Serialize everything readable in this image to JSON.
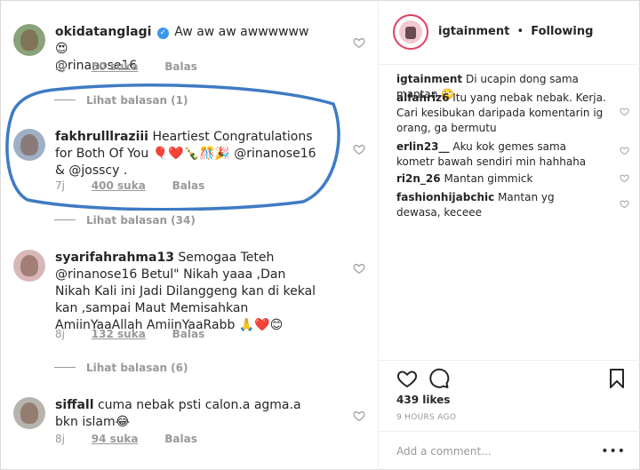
{
  "left_panel": {
    "comments": [
      {
        "username": "okidatanglagi",
        "verified": true,
        "text": "Aw aw aw awwwwww 😍",
        "mention": "@rinanose16",
        "time": "2j",
        "likes": "50 suka",
        "reply": "Balas"
      },
      {
        "view_replies": "Lihat balasan (1)"
      },
      {
        "username": "fakhrulllraziii",
        "text": "Heartiest Congratulations for Both Of You 🎈❤️🍾🎊🎉 @rinanose16 & @josscy .",
        "time": "7j",
        "likes": "400 suka",
        "reply": "Balas"
      },
      {
        "view_replies": "Lihat balasan (34)"
      },
      {
        "username": "syarifahrahma13",
        "text": "Semogaa Teteh @rinanose16 Betul\" Nikah yaaa ,Dan Nikah Kali ini Jadi Dilanggeng kan di kekal kan ,sampai Maut Memisahkan AmiinYaaAllah AmiinYaaRabb 🙏❤️😊",
        "time": "8j",
        "likes": "132 suka",
        "reply": "Balas"
      },
      {
        "view_replies": "Lihat balasan (6)"
      },
      {
        "username": "siffall",
        "text": "cuma nebak psti calon.a agma.a bkn islam😂",
        "time": "8j",
        "likes": "94 suka",
        "reply": "Balas"
      }
    ]
  },
  "right_panel": {
    "header": {
      "username": "igtainment",
      "separator": "•",
      "follow_status": "Following"
    },
    "comments": [
      {
        "username": "igtainment",
        "text": "Di ucapin dong sama mantan 🙄"
      },
      {
        "username": "alfahriz6",
        "text": "Itu yang nebak nebak. Kerja. Cari kesibukan daripada komentarin ig orang, ga bermutu"
      },
      {
        "username": "erlin23__",
        "text": "Aku kok gemes sama kometr bawah sendiri min hahhaha"
      },
      {
        "username": "ri2n_26",
        "text": "Mantan gimmick"
      },
      {
        "username": "fashionhijabchic",
        "text": "Mantan yg dewasa, keceee"
      }
    ],
    "likes": "439 likes",
    "time_ago": "9 HOURS AGO",
    "add_comment_placeholder": "Add a comment...",
    "more_options": "•••"
  },
  "colors": {
    "annotation_circle": "#3f7bc4",
    "link_blue": "#3897f0",
    "muted_gray": "#999999",
    "text": "#262626"
  },
  "icons": [
    "verified-badge-icon",
    "heart-outline-icon",
    "comment-bubble-icon",
    "bookmark-icon",
    "more-options-icon"
  ]
}
